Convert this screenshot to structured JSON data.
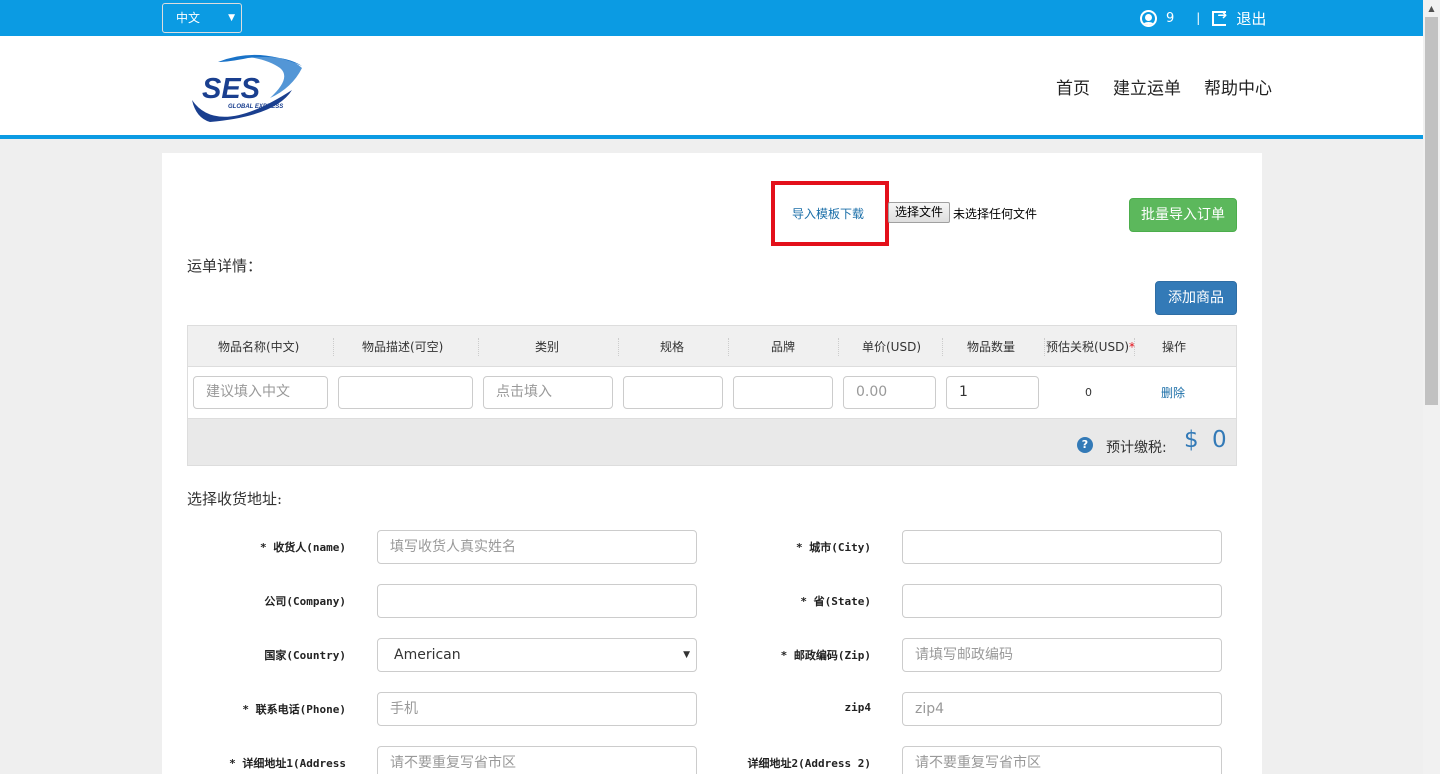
{
  "topbar": {
    "language": "中文",
    "user_count": "9",
    "divider": "|",
    "logout": "退出"
  },
  "header": {
    "logo_text": "SES",
    "logo_subtext": "GLOBAL EXPRESS",
    "nav": [
      "首页",
      "建立运单",
      "帮助中心"
    ]
  },
  "import": {
    "template_link": "导入模板下载",
    "file_button": "选择文件",
    "file_status": "未选择任何文件",
    "batch_button": "批量导入订单"
  },
  "waybill": {
    "section_title": "运单详情：",
    "add_button": "添加商品",
    "columns": [
      "物品名称(中文)",
      "物品描述(可空)",
      "类别",
      "规格",
      "品牌",
      "单价(USD)",
      "物品数量",
      "预估关税(USD)",
      "操作"
    ],
    "required_mark": "*",
    "row": {
      "name_placeholder": "建议填入中文",
      "desc_value": "",
      "category_placeholder": "点击填入",
      "spec_value": "",
      "brand_value": "",
      "price_placeholder": "0.00",
      "qty_value": "1",
      "tax_value": "0",
      "delete": "删除"
    },
    "estimate_label": "预计缴税:",
    "estimate_currency": "$",
    "estimate_amount": "0"
  },
  "address": {
    "section_title": "选择收货地址:",
    "fields_left": [
      {
        "label": "* 收货人(name)",
        "value": "填写收货人真实姓名",
        "is_placeholder": true
      },
      {
        "label": "公司(Company)",
        "value": "",
        "is_placeholder": true
      },
      {
        "label": "国家(Country)",
        "value": "American",
        "is_placeholder": false
      },
      {
        "label": "* 联系电话(Phone)",
        "value": "手机",
        "is_placeholder": true
      },
      {
        "label": "* 详细地址1(Address",
        "value": "请不要重复写省市区",
        "is_placeholder": true
      }
    ],
    "fields_right": [
      {
        "label": "* 城市(City)",
        "value": "",
        "is_placeholder": true
      },
      {
        "label": "* 省(State)",
        "value": "",
        "is_placeholder": true
      },
      {
        "label": "* 邮政编码(Zip)",
        "value": "请填写邮政编码",
        "is_placeholder": true
      },
      {
        "label": "zip4",
        "value": "zip4",
        "is_placeholder": true
      },
      {
        "label": "详细地址2(Address 2)",
        "value": "请不要重复写省市区",
        "is_placeholder": true
      }
    ]
  },
  "colors": {
    "brand_blue": "#0b9be3",
    "primary": "#337ab7",
    "success": "#5cb85c",
    "highlight": "#e3101a"
  }
}
